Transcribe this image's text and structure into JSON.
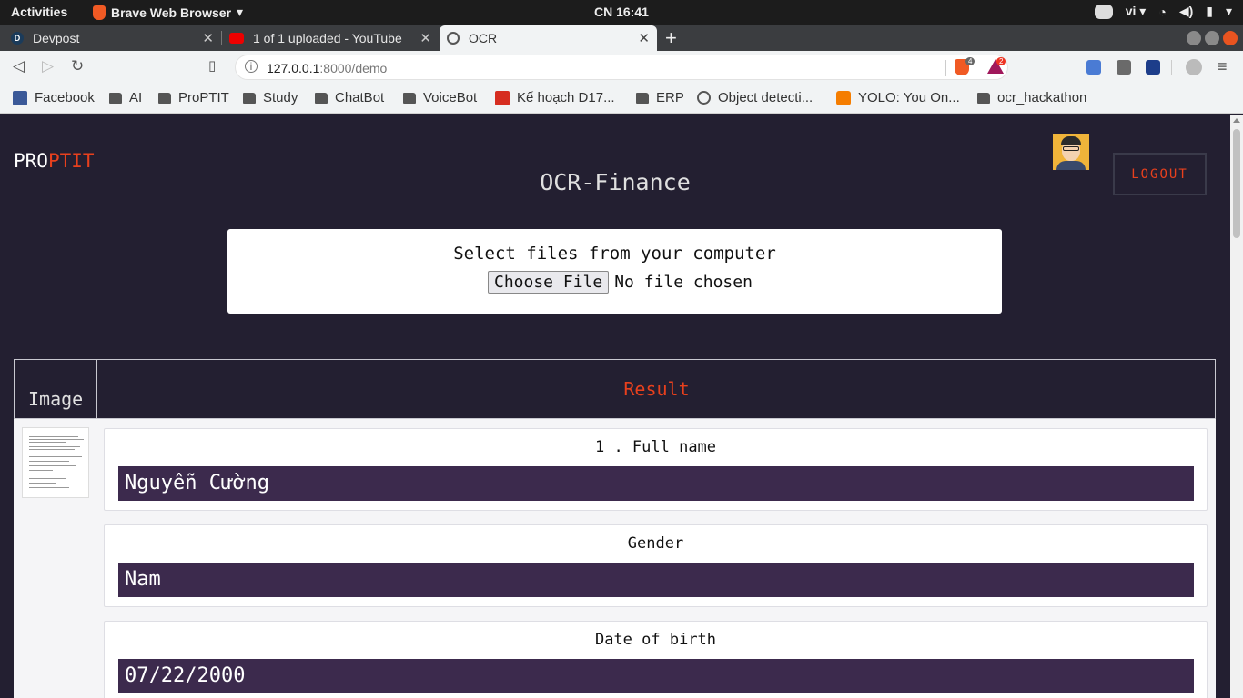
{
  "os": {
    "activities": "Activities",
    "app_name": "Brave Web Browser",
    "clock": "CN 16:41",
    "lang": "vi"
  },
  "tabs": [
    {
      "title": "Devpost",
      "favicon": "D"
    },
    {
      "title": "1 of 1 uploaded - YouTube"
    },
    {
      "title": "OCR"
    }
  ],
  "toolbar": {
    "url_host": "127.0.0.1",
    "url_path": ":8000/demo",
    "shield_count": "4",
    "rewards_count": "2"
  },
  "bookmarks": [
    {
      "label": "Facebook",
      "icon": "facebook-icon"
    },
    {
      "label": "AI",
      "icon": "folder-icon"
    },
    {
      "label": "ProPTIT",
      "icon": "folder-icon"
    },
    {
      "label": "Study",
      "icon": "folder-icon"
    },
    {
      "label": "ChatBot",
      "icon": "folder-icon"
    },
    {
      "label": "VoiceBot",
      "icon": "folder-icon"
    },
    {
      "label": "Kế hoạch D17...",
      "icon": "pdf-icon"
    },
    {
      "label": "ERP",
      "icon": "folder-icon"
    },
    {
      "label": "Object detecti...",
      "icon": "globe-icon"
    },
    {
      "label": "YOLO: You On...",
      "icon": "blogger-icon"
    },
    {
      "label": "ocr_hackathon",
      "icon": "folder-icon"
    }
  ],
  "page": {
    "brand_main": "PRO",
    "brand_accent": "PTIT",
    "title": "OCR-Finance",
    "logout_label": "LOGOUT",
    "upload_prompt": "Select files from your computer",
    "choose_file_label": "Choose File",
    "no_file_text": "No file chosen",
    "col_image": "Image",
    "col_result": "Result",
    "fields": [
      {
        "label": "1 . Full name",
        "value": "Nguyễn Cường"
      },
      {
        "label": "Gender",
        "value": "Nam"
      },
      {
        "label": "Date of birth",
        "value": "07/22/2000"
      }
    ]
  },
  "colors": {
    "accent": "#e8401d",
    "page_bg": "#231f31",
    "value_bg": "#3c2a4d"
  }
}
